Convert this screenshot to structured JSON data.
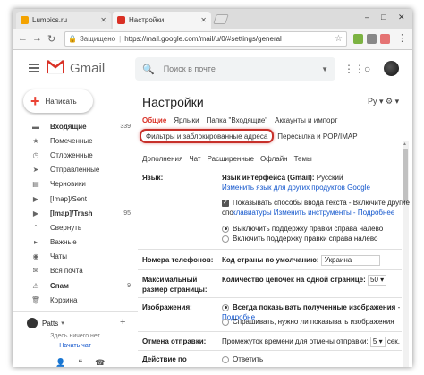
{
  "browser": {
    "tabs": [
      {
        "label": "Lumpics.ru",
        "active": false,
        "favicon_color": "#f4a300"
      },
      {
        "label": "Настройки",
        "active": true,
        "favicon_color": "#d93025"
      }
    ],
    "window_controls": [
      "–",
      "□",
      "✕"
    ],
    "address": {
      "secure_label": "Защищено",
      "url": "https://mail.google.com/mail/u/0/#settings/general"
    }
  },
  "gmail": {
    "logo_text": "Gmail",
    "search_placeholder": "Поиск в почте",
    "compose_label": "Написать",
    "nav": [
      {
        "label": "Входящие",
        "count": "339",
        "icon": "inbox-icon",
        "glyph": "▬",
        "bold": true
      },
      {
        "label": "Помеченные",
        "count": "",
        "icon": "star-icon",
        "glyph": "★",
        "bold": false
      },
      {
        "label": "Отложенные",
        "count": "",
        "icon": "clock-icon",
        "glyph": "◷",
        "bold": false
      },
      {
        "label": "Отправленные",
        "count": "",
        "icon": "send-icon",
        "glyph": "➤",
        "bold": false
      },
      {
        "label": "Черновики",
        "count": "",
        "icon": "draft-icon",
        "glyph": "▤",
        "bold": false
      },
      {
        "label": "[Imap]/Sent",
        "count": "",
        "icon": "label-icon",
        "glyph": "▶",
        "bold": false
      },
      {
        "label": "[Imap]/Trash",
        "count": "95",
        "icon": "label-icon",
        "glyph": "▶",
        "bold": true
      },
      {
        "label": "Свернуть",
        "count": "",
        "icon": "chevron-up-icon",
        "glyph": "⌃",
        "bold": false
      },
      {
        "label": "Важные",
        "count": "",
        "icon": "important-icon",
        "glyph": "▸",
        "bold": false
      },
      {
        "label": "Чаты",
        "count": "",
        "icon": "chat-icon",
        "glyph": "◉",
        "bold": false
      },
      {
        "label": "Вся почта",
        "count": "",
        "icon": "all-mail-icon",
        "glyph": "✉",
        "bold": false
      },
      {
        "label": "Спам",
        "count": "9",
        "icon": "spam-icon",
        "glyph": "⚠",
        "bold": true
      },
      {
        "label": "Корзина",
        "count": "",
        "icon": "trash-icon",
        "glyph": "🗑",
        "bold": false
      }
    ],
    "chat": {
      "user": "Patts",
      "hint": "Здесь ничего нет",
      "start_chat": "Начать чат"
    }
  },
  "settings": {
    "title": "Настройки",
    "lang_selector": "Ру",
    "tabs_row1": [
      "Общие",
      "Ярлыки",
      "Папка \"Входящие\"",
      "Аккаунты и импорт"
    ],
    "tabs_row2": [
      "Фильтры и заблокированные адреса",
      "Пересылка и POP/IMAP"
    ],
    "tabs_row3": [
      "Дополнения",
      "Чат",
      "Расширенные",
      "Офлайн",
      "Темы"
    ],
    "language": {
      "label": "Язык:",
      "interface_label": "Язык интерфейса (Gmail):",
      "interface_value": "Русский",
      "change_link": "Изменить язык для других продуктов Google",
      "input_methods": "Показывать способы ввода текста",
      "input_methods_tail": " - Включите другие спо",
      "input_methods_link": "клавиатуры",
      "input_methods_more": "Изменить инструменты - Подробнее",
      "rtl_off": "Выключить поддержку правки справа налево",
      "rtl_on": "Включить поддержку правки справа налево"
    },
    "phone": {
      "label": "Номера телефонов:",
      "default_label": "Код страны по умолчанию:",
      "default_value": "Украина"
    },
    "page_size": {
      "label_line1": "Максимальный",
      "label_line2": "размер страницы:",
      "text": "Количество цепочек на одной странице:",
      "value": "50"
    },
    "images": {
      "label": "Изображения:",
      "always": "Всегда показывать полученные изображения",
      "always_link": "Подробне",
      "ask": "Спрашивать, нужно ли показывать изображения"
    },
    "undo": {
      "label": "Отмена отправки:",
      "text": "Промежуток времени для отмены отправки:",
      "value": "5",
      "unit": "сек."
    },
    "reply": {
      "label_line1": "Действие по",
      "option": "Ответить"
    }
  }
}
